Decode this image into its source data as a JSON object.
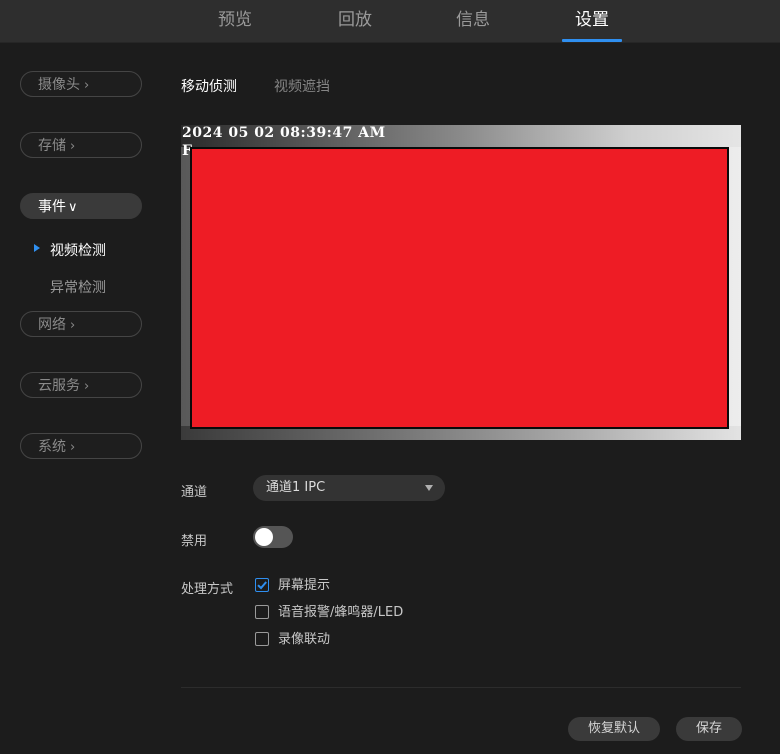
{
  "topnav": {
    "items": [
      {
        "label": "预览"
      },
      {
        "label": "回放"
      },
      {
        "label": "信息"
      },
      {
        "label": "设置",
        "active": true
      }
    ]
  },
  "sidebar": {
    "camera": "摄像头",
    "storage": "存储",
    "event": "事件",
    "event_sub": [
      "视频检测",
      "异常检测"
    ],
    "network": "网络",
    "cloud": "云服务",
    "system": "系统"
  },
  "subtabs": [
    "移动侦测",
    "视频遮挡"
  ],
  "preview": {
    "timestamp": "2024 05 02 08:39:47 AM",
    "overlay_char": "F",
    "motion_area_color": "#ee1c25"
  },
  "form": {
    "channel_label": "通道",
    "channel_value": "通道1 IPC",
    "disable_label": "禁用",
    "disable_on": false,
    "handling_label": "处理方式",
    "actions": [
      {
        "label": "屏幕提示",
        "checked": true
      },
      {
        "label": "语音报警/蜂鸣器/LED",
        "checked": false
      },
      {
        "label": "录像联动",
        "checked": false
      }
    ]
  },
  "buttons": {
    "restore_default": "恢复默认",
    "save": "保存"
  },
  "colors": {
    "accent": "#2f8ff0",
    "background": "#1c1c1c",
    "topbar": "#2e2e2e"
  }
}
